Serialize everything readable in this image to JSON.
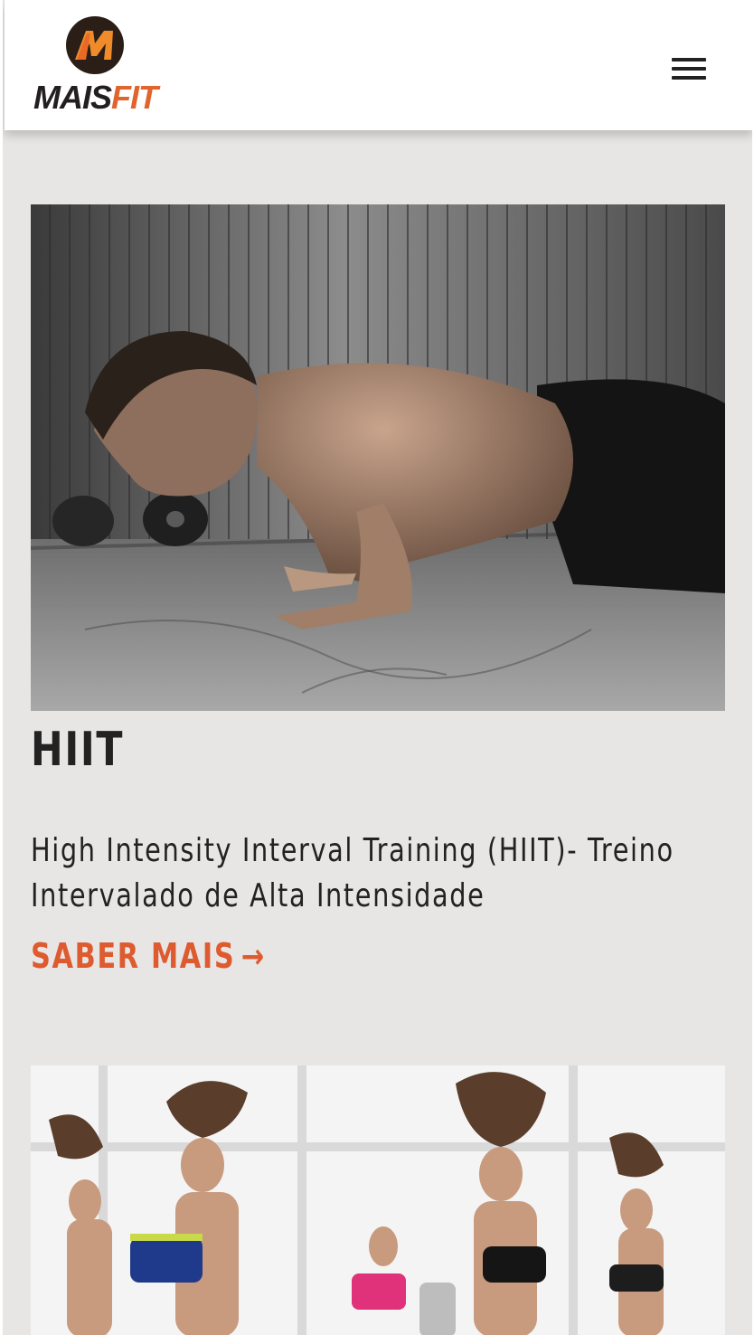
{
  "header": {
    "logo_text_mais": "MAIS",
    "logo_text_fit": "FIT",
    "menu_icon": "hamburger-menu-icon"
  },
  "colors": {
    "brand_orange": "#e0642c",
    "brand_dark": "#231f20",
    "page_background": "#e8e6e5",
    "link": "#de5b30"
  },
  "cards": [
    {
      "image": "man doing push-ups on concrete floor",
      "title": "HIIT",
      "description": "High Intensity Interval Training (HIIT)- Treino Intervalado de Alta Intensidade",
      "link_label": "SABER MAIS",
      "link_arrow": "→"
    },
    {
      "image": "women dancing in group fitness class"
    }
  ]
}
